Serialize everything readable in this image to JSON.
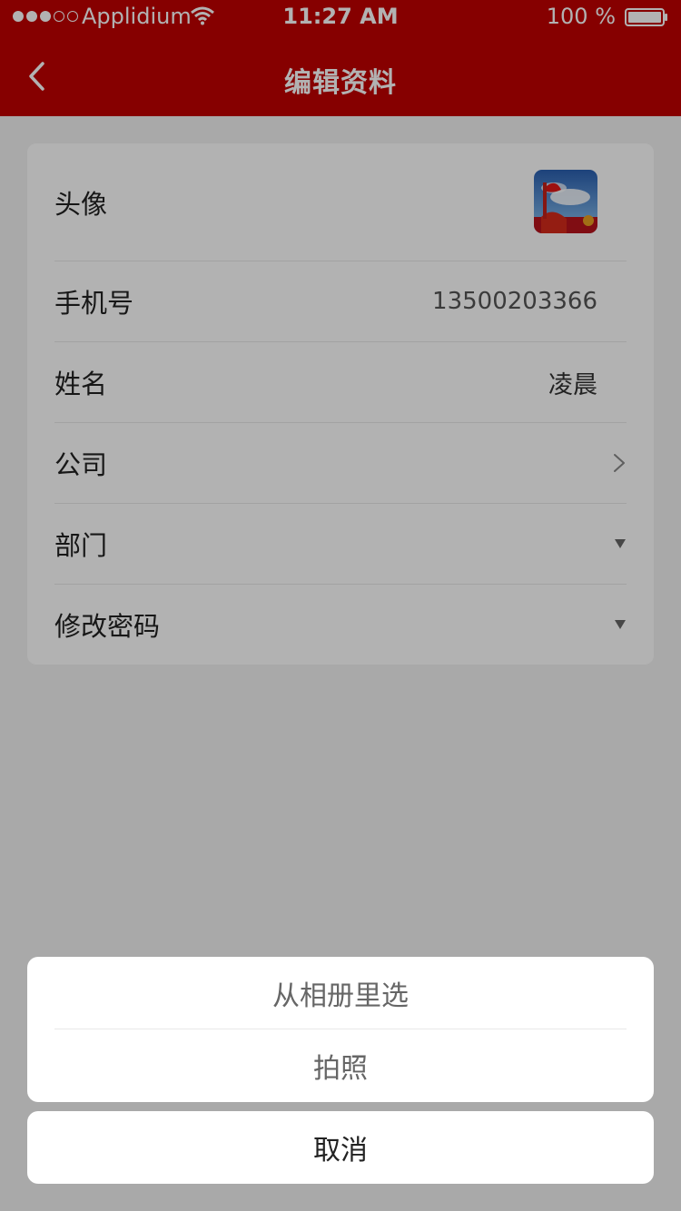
{
  "status_bar": {
    "carrier": "Applidium",
    "time": "11:27 AM",
    "battery": "100 %"
  },
  "nav": {
    "title": "编辑资料",
    "back_icon": "chevron-left-icon"
  },
  "profile": {
    "avatar_label": "头像",
    "phone_label": "手机号",
    "phone_value": "13500203366",
    "name_label": "姓名",
    "name_value": "凌晨",
    "company_label": "公司",
    "department_label": "部门",
    "password_label": "修改密码"
  },
  "action_sheet": {
    "album_label": "从相册里选",
    "camera_label": "拍照",
    "cancel_label": "取消"
  },
  "colors": {
    "header": "#c00000",
    "overlay": "rgba(0,0,0,0.3)"
  }
}
